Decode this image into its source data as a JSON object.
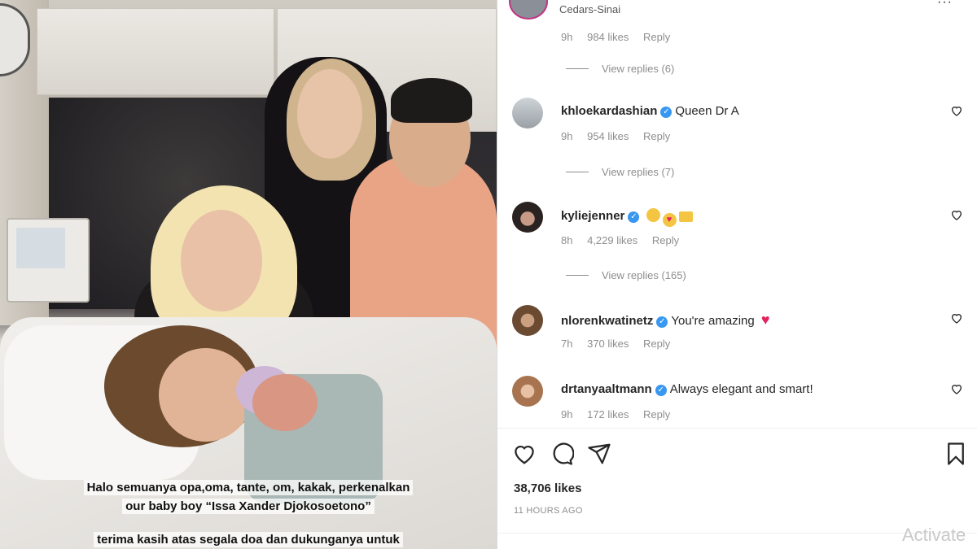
{
  "header": {
    "location": "Cedars-Sinai",
    "more_label": "···"
  },
  "photo": {
    "caption_line1": "Halo semuanya opa,oma, tante, om, kakak, perkenalkan",
    "caption_line2": "our baby boy “Issa Xander Djokosoetono”",
    "caption_line3": "terima kasih atas segala doa dan dukunganya untuk"
  },
  "top_comment_meta": {
    "time": "9h",
    "likes": "984 likes",
    "reply": "Reply"
  },
  "top_view_replies": "View replies (6)",
  "comments": [
    {
      "username": "khloekardashian",
      "text": "Queen Dr A",
      "time": "9h",
      "likes": "954 likes",
      "reply": "Reply",
      "view_replies": "View replies (7)"
    },
    {
      "username": "kyliejenner",
      "text": "",
      "time": "8h",
      "likes": "4,229 likes",
      "reply": "Reply",
      "view_replies": "View replies (165)"
    },
    {
      "username": "nlorenkwatinetz",
      "text": "You're amazing",
      "time": "7h",
      "likes": "370 likes",
      "reply": "Reply"
    },
    {
      "username": "drtanyaaltmann",
      "text": "Always elegant and smart!",
      "time": "9h",
      "likes": "172 likes",
      "reply": "Reply"
    }
  ],
  "post": {
    "likes": "38,706 likes",
    "time_ago": "11 HOURS AGO"
  },
  "watermark": "Activate",
  "colors": {
    "verified": "#3897f0",
    "muted": "#8e8e8e",
    "text": "#262626"
  }
}
